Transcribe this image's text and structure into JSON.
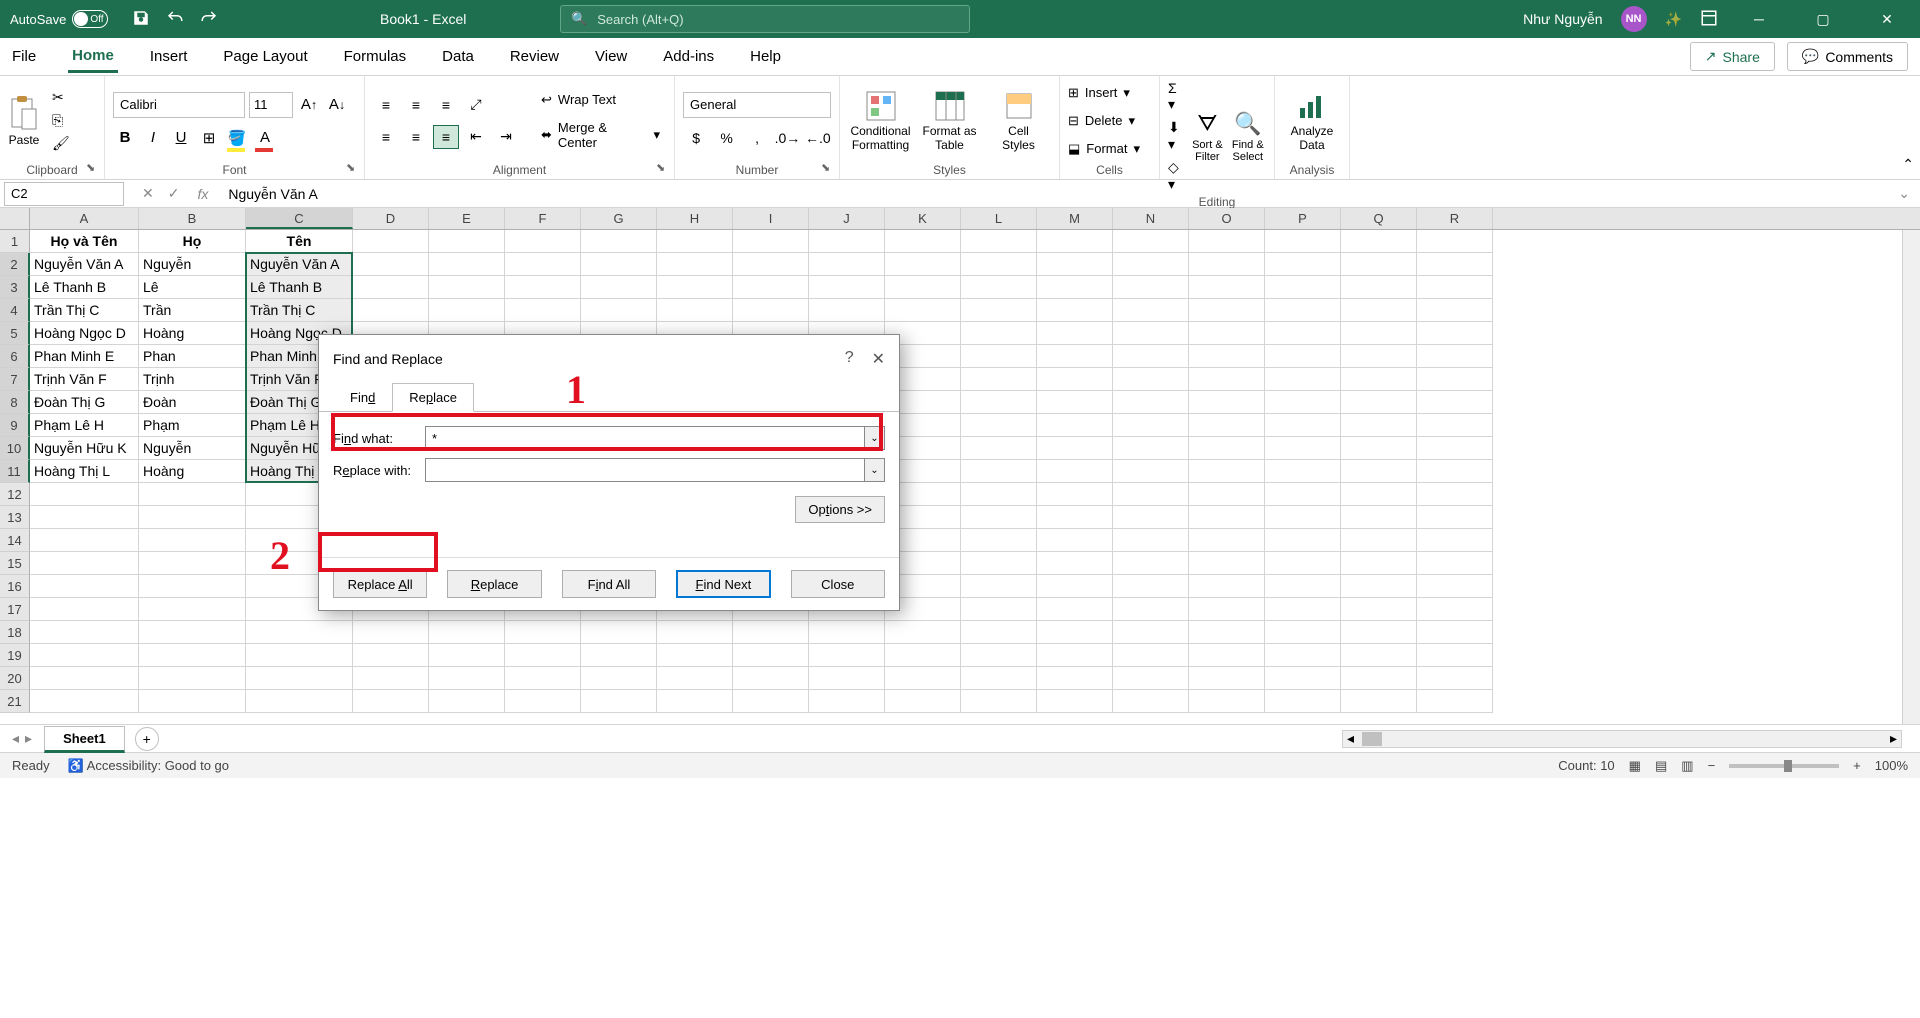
{
  "title_bar": {
    "autosave_label": "AutoSave",
    "autosave_state": "Off",
    "doc_title": "Book1 - Excel",
    "search_placeholder": "Search (Alt+Q)",
    "user_name": "Như Nguyễn",
    "user_initials": "NN"
  },
  "menu": {
    "items": [
      "File",
      "Home",
      "Insert",
      "Page Layout",
      "Formulas",
      "Data",
      "Review",
      "View",
      "Add-ins",
      "Help"
    ],
    "active": "Home",
    "share": "Share",
    "comments": "Comments"
  },
  "ribbon": {
    "clipboard": {
      "paste": "Paste",
      "label": "Clipboard"
    },
    "font": {
      "name": "Calibri",
      "size": "11",
      "label": "Font"
    },
    "alignment": {
      "wrap": "Wrap Text",
      "merge": "Merge & Center",
      "label": "Alignment"
    },
    "number": {
      "format": "General",
      "label": "Number"
    },
    "styles": {
      "conditional": "Conditional\nFormatting",
      "format_table": "Format as\nTable",
      "cell_styles": "Cell\nStyles",
      "label": "Styles"
    },
    "cells": {
      "insert": "Insert",
      "delete": "Delete",
      "format": "Format",
      "label": "Cells"
    },
    "editing": {
      "sort": "Sort &\nFilter",
      "find": "Find &\nSelect",
      "label": "Editing"
    },
    "analysis": {
      "analyze": "Analyze\nData",
      "label": "Analysis"
    }
  },
  "formula_bar": {
    "name_box": "C2",
    "formula": "Nguyễn Văn A"
  },
  "columns": [
    "A",
    "B",
    "C",
    "D",
    "E",
    "F",
    "G",
    "H",
    "I",
    "J",
    "K",
    "L",
    "M",
    "N",
    "O",
    "P",
    "Q",
    "R"
  ],
  "col_widths": {
    "A": 109,
    "B": 107,
    "C": 107,
    "default": 76
  },
  "data": {
    "headers": [
      "Họ và Tên",
      "Họ",
      "Tên"
    ],
    "rows": [
      [
        "Nguyễn Văn A",
        "Nguyễn",
        "Nguyễn Văn A"
      ],
      [
        "Lê Thanh B",
        "Lê",
        "Lê Thanh B"
      ],
      [
        "Trần Thị C",
        "Trần",
        "Trần Thị C"
      ],
      [
        "Hoàng Ngọc D",
        "Hoàng",
        "Hoàng Ngọc D"
      ],
      [
        "Phan Minh E",
        "Phan",
        "Phan Minh E"
      ],
      [
        "Trịnh Văn F",
        "Trịnh",
        "Trịnh Văn F"
      ],
      [
        "Đoàn Thị G",
        "Đoàn",
        "Đoàn Thị G"
      ],
      [
        "Phạm Lê H",
        "Phạm",
        "Phạm Lê H"
      ],
      [
        "Nguyễn Hữu K",
        "Nguyễn",
        "Nguyễn Hữu K"
      ],
      [
        "Hoàng Thị L",
        "Hoàng",
        "Hoàng Thị L"
      ]
    ]
  },
  "selected_range": "C2:C11",
  "sheet": {
    "name": "Sheet1"
  },
  "status": {
    "ready": "Ready",
    "accessibility": "Accessibility: Good to go",
    "count_label": "Count:",
    "count_value": "10",
    "zoom": "100%"
  },
  "dialog": {
    "title": "Find and Replace",
    "tab_find": "Find",
    "tab_replace": "Replace",
    "find_label": "Find what:",
    "find_value": "*",
    "replace_label": "Replace with:",
    "replace_value": "",
    "options": "Options >>",
    "btn_replace_all": "Replace All",
    "btn_replace": "Replace",
    "btn_find_all": "Find All",
    "btn_find_next": "Find Next",
    "btn_close": "Close"
  },
  "annotations": {
    "num1": "1",
    "num2": "2"
  }
}
